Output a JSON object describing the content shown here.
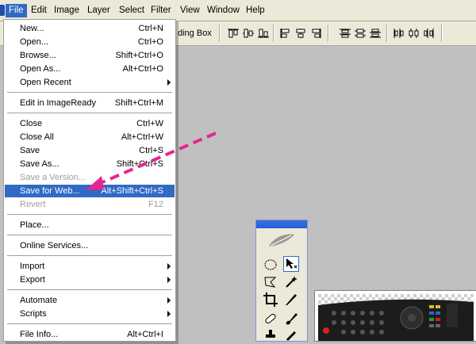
{
  "menubar": {
    "items": [
      "File",
      "Edit",
      "Image",
      "Layer",
      "Select",
      "Filter",
      "View",
      "Window",
      "Help"
    ]
  },
  "toolbar": {
    "partial_label": "ding Box"
  },
  "file_menu": {
    "new": {
      "label": "New...",
      "shortcut": "Ctrl+N"
    },
    "open": {
      "label": "Open...",
      "shortcut": "Ctrl+O"
    },
    "browse": {
      "label": "Browse...",
      "shortcut": "Shift+Ctrl+O"
    },
    "open_as": {
      "label": "Open As...",
      "shortcut": "Alt+Ctrl+O"
    },
    "open_recent": {
      "label": "Open Recent"
    },
    "edit_imageready": {
      "label": "Edit in ImageReady",
      "shortcut": "Shift+Ctrl+M"
    },
    "close": {
      "label": "Close",
      "shortcut": "Ctrl+W"
    },
    "close_all": {
      "label": "Close All",
      "shortcut": "Alt+Ctrl+W"
    },
    "save": {
      "label": "Save",
      "shortcut": "Ctrl+S"
    },
    "save_as": {
      "label": "Save As...",
      "shortcut": "Shift+Ctrl+S"
    },
    "save_version": {
      "label": "Save a Version..."
    },
    "save_for_web": {
      "label": "Save for Web...",
      "shortcut": "Alt+Shift+Ctrl+S"
    },
    "revert": {
      "label": "Revert",
      "shortcut": "F12"
    },
    "place": {
      "label": "Place..."
    },
    "online_services": {
      "label": "Online Services..."
    },
    "import": {
      "label": "Import"
    },
    "export": {
      "label": "Export"
    },
    "automate": {
      "label": "Automate"
    },
    "scripts": {
      "label": "Scripts"
    },
    "file_info": {
      "label": "File Info...",
      "shortcut": "Alt+Ctrl+I"
    }
  },
  "colors": {
    "highlight": "#316ac5",
    "annotation_arrow": "#e8258f",
    "menubar_bg": "#ece9d8"
  }
}
